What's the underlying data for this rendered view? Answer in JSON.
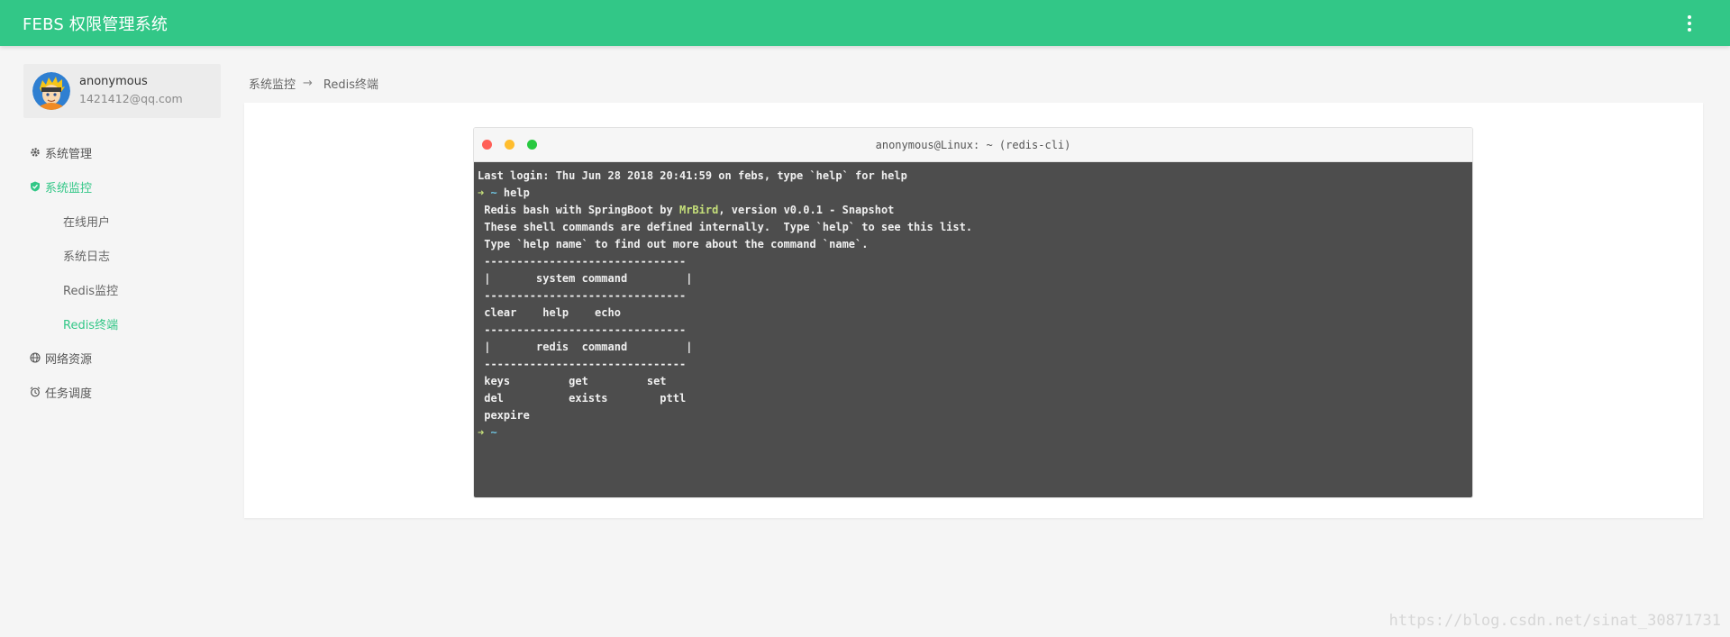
{
  "header": {
    "title": "FEBS 权限管理系统",
    "menu_icon": "more-vertical-icon"
  },
  "user": {
    "name": "anonymous",
    "email": "1421412@qq.com"
  },
  "sidebar": {
    "items": [
      {
        "label": "系统管理",
        "icon": "gear-icon"
      },
      {
        "label": "系统监控",
        "icon": "shield-icon",
        "active": true
      },
      {
        "label": "在线用户",
        "sub": true
      },
      {
        "label": "系统日志",
        "sub": true
      },
      {
        "label": "Redis监控",
        "sub": true
      },
      {
        "label": "Redis终端",
        "sub": true,
        "active": true
      },
      {
        "label": "网络资源",
        "icon": "globe-icon"
      },
      {
        "label": "任务调度",
        "icon": "alarm-clock-icon"
      }
    ]
  },
  "breadcrumb": {
    "parent": "系统监控",
    "separator": "→",
    "current": "Redis终端"
  },
  "terminal": {
    "title": "anonymous@Linux: ~ (redis-cli)",
    "prompt_arrow": "➜",
    "prompt_dir": "~",
    "last_login": "Last login: Thu Jun 28 2018 20:41:59 on febs, type `help` for help",
    "command": " help",
    "intro_prefix": " Redis bash with SpringBoot by ",
    "intro_author": "MrBird",
    "intro_suffix": ", version v0.0.1 - Snapshot",
    "line_defined": " These shell commands are defined internally.  Type `help` to see this list.",
    "line_help": " Type `help name` to find out more about the command `name`.",
    "divider": " -------------------------------",
    "system_header": " |       system command         |",
    "system_cmds": " clear    help    echo",
    "redis_header": " |       redis  command         |",
    "redis_cmds_1": " keys         get         set",
    "redis_cmds_2": " del          exists        pttl",
    "redis_cmds_3": " pexpire"
  },
  "watermark": "https://blog.csdn.net/sinat_30871731",
  "colors": {
    "primary": "#32c787",
    "terminal_bg": "#4d4d4d"
  }
}
